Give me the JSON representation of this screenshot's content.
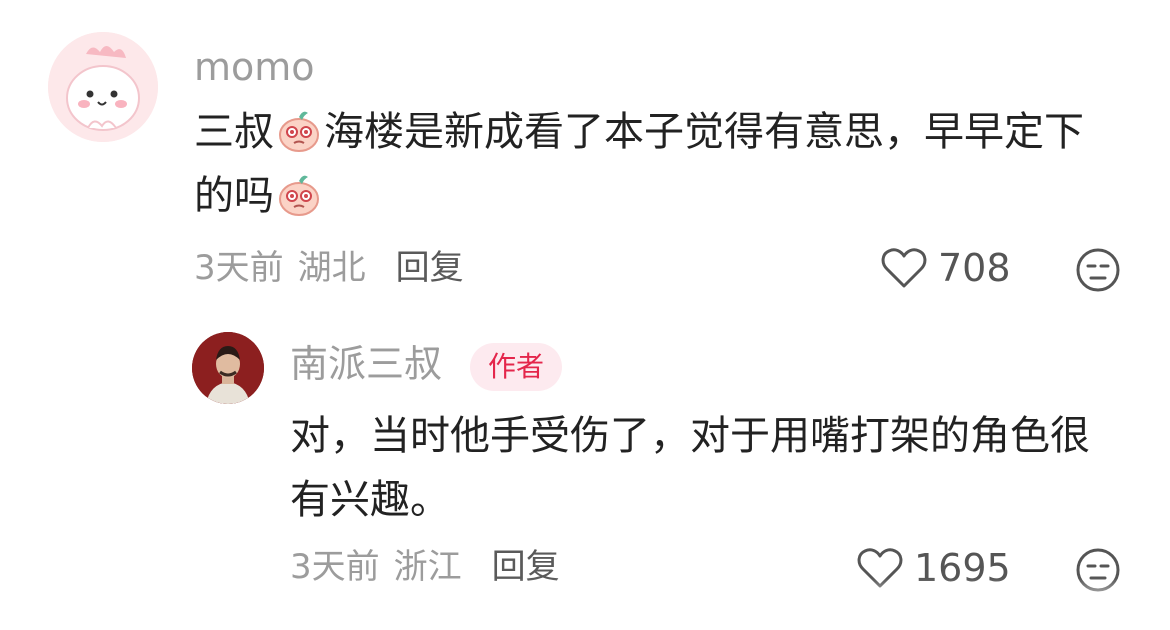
{
  "comments": [
    {
      "username": "momo",
      "text_line1_a": "三叔",
      "text_line1_b": "海楼是新成看了本子觉得有意思，早早定下",
      "text_line2": "的吗",
      "time": "3天前",
      "location": "湖北",
      "reply_label": "回复",
      "likes": "708"
    }
  ],
  "reply": {
    "username": "南派三叔",
    "badge": "作者",
    "text_line1": "对，当时他手受伤了，对于用嘴打架的角色很",
    "text_line2": "有兴趣。",
    "time": "3天前",
    "location": "浙江",
    "reply_label": "回复",
    "likes": "1695"
  },
  "icons": {
    "like": "heart-outline-icon",
    "dislike": "meh-face-icon",
    "emoji": "pink-creature-emoji"
  },
  "colors": {
    "username": "#9c9c9c",
    "text": "#222222",
    "badge_bg": "#fdeaef",
    "badge_text": "#e4264b"
  }
}
